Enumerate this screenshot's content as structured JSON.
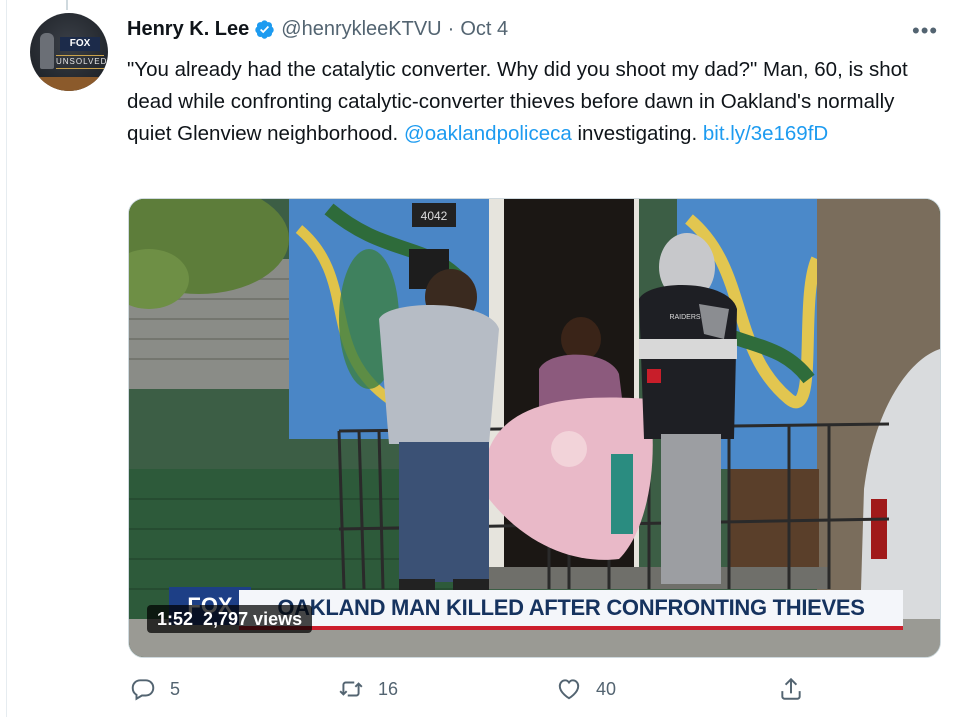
{
  "tweet": {
    "author_name": "Henry K. Lee",
    "handle": "@henrykleeKTVU",
    "separator": "·",
    "date": "Oct 4",
    "more_label": "•••",
    "text_main": "\"You already had the catalytic converter. Why did you shoot my dad?\" Man, 60, is shot dead while confronting catalytic-converter thieves before dawn in Oakland's normally quiet Glenview neighborhood. ",
    "mention": "@oaklandpoliceca",
    "text_after_mention": " investigating. ",
    "link": "bit.ly/3e169fD"
  },
  "avatar": {
    "logo_text": "FOX",
    "caption": "UNSOLVED"
  },
  "media": {
    "duration": "1:52",
    "views": "2,797 views",
    "banner_text": "OAKLAND MAN KILLED AFTER CONFRONTING THIEVES",
    "channel_logo_text": "FOX",
    "house_number": "4042",
    "jacket_text": "RAIDERS"
  },
  "actions": {
    "replies": "5",
    "retweets": "16",
    "likes": "40"
  },
  "colors": {
    "accent": "#1d9bf0",
    "secondary_text": "#536471",
    "banner_red": "#cc1e2c",
    "banner_navy": "#16335f"
  },
  "icons": [
    "verified-badge-icon",
    "more-icon",
    "reply-icon",
    "retweet-icon",
    "like-icon",
    "share-icon"
  ]
}
